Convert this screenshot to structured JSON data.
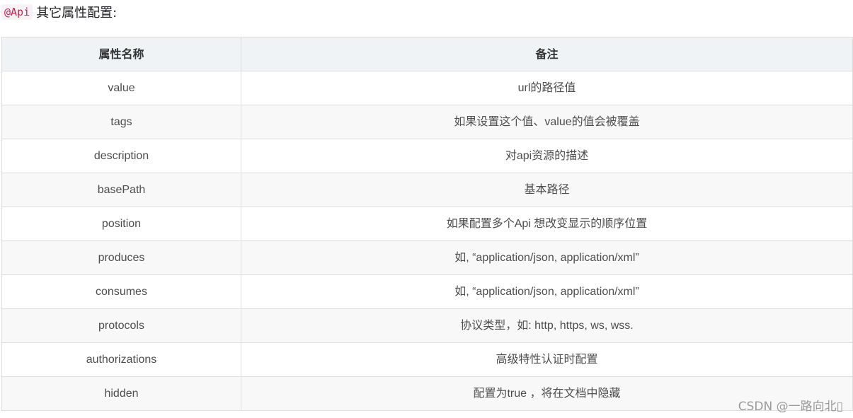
{
  "intro": {
    "code": "@Api",
    "text": "其它属性配置:"
  },
  "table": {
    "headers": [
      "属性名称",
      "备注"
    ],
    "rows": [
      [
        "value",
        "url的路径值"
      ],
      [
        "tags",
        "如果设置这个值、value的值会被覆盖"
      ],
      [
        "description",
        "对api资源的描述"
      ],
      [
        "basePath",
        "基本路径"
      ],
      [
        "position",
        "如果配置多个Api 想改变显示的顺序位置"
      ],
      [
        "produces",
        "如, “application/json, application/xml”"
      ],
      [
        "consumes",
        "如, “application/json, application/xml”"
      ],
      [
        "protocols",
        "协议类型，如: http, https, ws, wss."
      ],
      [
        "authorizations",
        "高级特性认证时配置"
      ],
      [
        "hidden",
        "配置为true ，将在文档中隐藏"
      ]
    ]
  },
  "watermark": "CSDN @一路向北▯"
}
